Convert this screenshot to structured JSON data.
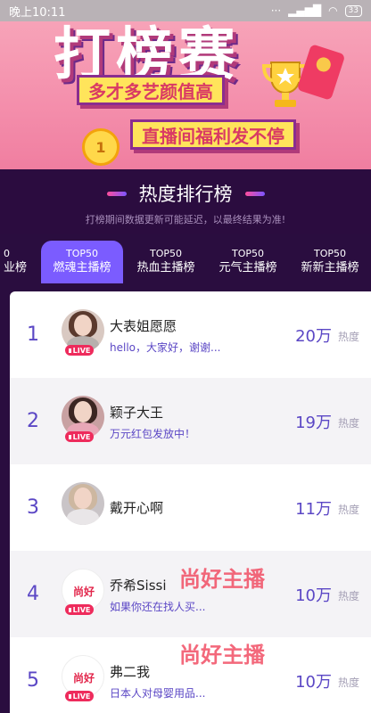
{
  "status": {
    "time": "晚上10:11",
    "battery": "33"
  },
  "banner": {
    "title": "打榜赛",
    "tag1": "多才多艺颜值高",
    "tag2": "直播间福利发不停",
    "medal": "1"
  },
  "header": {
    "title": "热度排行榜",
    "subtitle": "打榜期间数据更新可能延迟，以最终结果为准!"
  },
  "tabs": [
    {
      "top": "0",
      "label": "业榜"
    },
    {
      "top": "TOP50",
      "label": "燃魂主播榜"
    },
    {
      "top": "TOP50",
      "label": "热血主播榜"
    },
    {
      "top": "TOP50",
      "label": "元气主播榜"
    },
    {
      "top": "TOP50",
      "label": "新新主播榜"
    }
  ],
  "list": [
    {
      "rank": "1",
      "name": "大表姐愿愿",
      "sub": "hello，大家好，谢谢...",
      "score": "20万",
      "heat_label": "热度",
      "live": "LIVE"
    },
    {
      "rank": "2",
      "name": "颖子大王",
      "sub": "万元红包发放中！",
      "score": "19万",
      "heat_label": "热度",
      "live": "LIVE"
    },
    {
      "rank": "3",
      "name": "戴开心啊",
      "sub": "",
      "score": "11万",
      "heat_label": "热度",
      "live": ""
    },
    {
      "rank": "4",
      "name": "乔希Sissi",
      "sub": "如果你还在找人买...",
      "score": "10万",
      "heat_label": "热度",
      "live": "LIVE"
    },
    {
      "rank": "5",
      "name": "弗二我",
      "sub": "日本人对母婴用品...",
      "score": "10万",
      "heat_label": "热度",
      "live": "LIVE"
    }
  ],
  "brand_mark": "尚好",
  "watermark": "尚好主播",
  "colors": {
    "accent": "#7b5cff",
    "rank_text": "#5b47c5",
    "live": "#ee2b5c"
  }
}
